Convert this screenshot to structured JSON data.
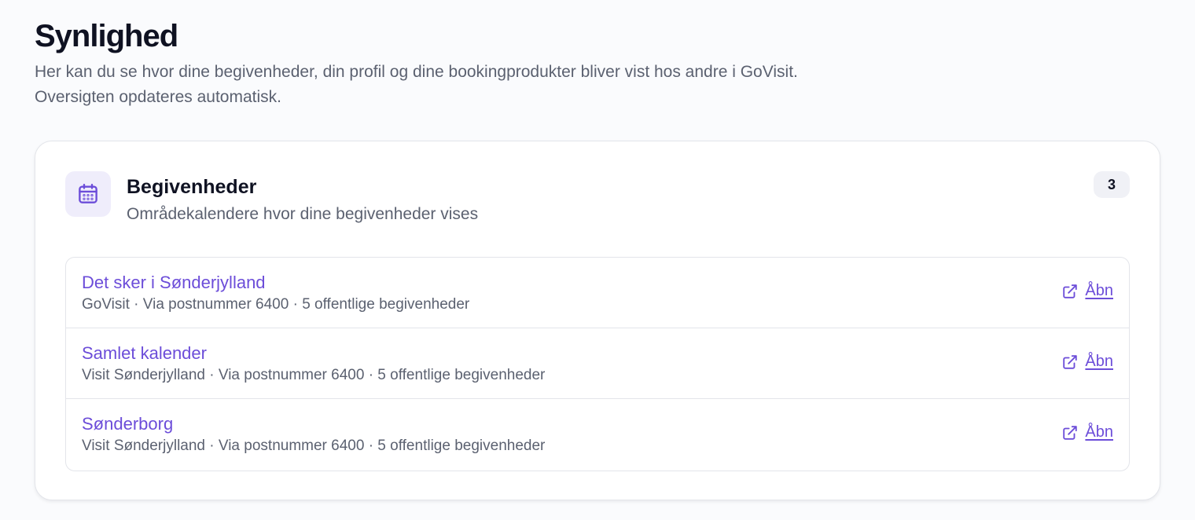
{
  "header": {
    "title": "Synlighed",
    "description": "Her kan du se hvor dine begivenheder, din profil og dine bookingprodukter bliver vist hos andre i GoVisit. Oversigten opdateres automatisk."
  },
  "events_card": {
    "icon": "calendar-icon",
    "title": "Begivenheder",
    "subtitle": "Områdekalendere hvor dine begivenheder vises",
    "count": "3",
    "open_label": "Åbn",
    "items": [
      {
        "name": "Det sker i Sønderjylland",
        "meta": "GoVisit · Via postnummer 6400 · 5 offentlige begivenheder"
      },
      {
        "name": "Samlet kalender",
        "meta": "Visit Sønderjylland · Via postnummer 6400 · 5 offentlige begivenheder"
      },
      {
        "name": "Sønderborg",
        "meta": "Visit Sønderjylland · Via postnummer 6400 · 5 offentlige begivenheder"
      }
    ]
  },
  "colors": {
    "accent": "#6c4dd9",
    "icon_tile_bg": "#efedfb",
    "muted_text": "#5b6170",
    "border": "#e3e5ea"
  }
}
